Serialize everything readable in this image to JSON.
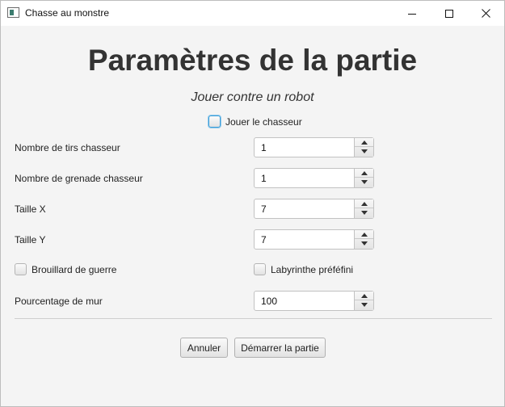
{
  "window": {
    "title": "Chasse au monstre",
    "icon": "app-window-icon"
  },
  "form": {
    "heading": "Paramètres de la partie",
    "subheading": "Jouer contre un robot",
    "play_hunter": {
      "label": "Jouer le chasseur",
      "checked": false
    },
    "fields": [
      {
        "label": "Nombre de tirs chasseur",
        "value": "1"
      },
      {
        "label": "Nombre de grenade chasseur",
        "value": "1"
      },
      {
        "label": "Taille X",
        "value": "7"
      },
      {
        "label": "Taille Y",
        "value": "7"
      }
    ],
    "fog_of_war": {
      "label": "Brouillard de guerre",
      "checked": false
    },
    "predefined_maze": {
      "label": "Labyrinthe préféfini",
      "checked": false
    },
    "wall_percentage": {
      "label": "Pourcentage de mur",
      "value": "100"
    }
  },
  "buttons": {
    "cancel": "Annuler",
    "start": "Démarrer la partie"
  },
  "colors": {
    "focus": "#3c9ed8",
    "heading": "#333333",
    "background": "#f4f4f4"
  }
}
